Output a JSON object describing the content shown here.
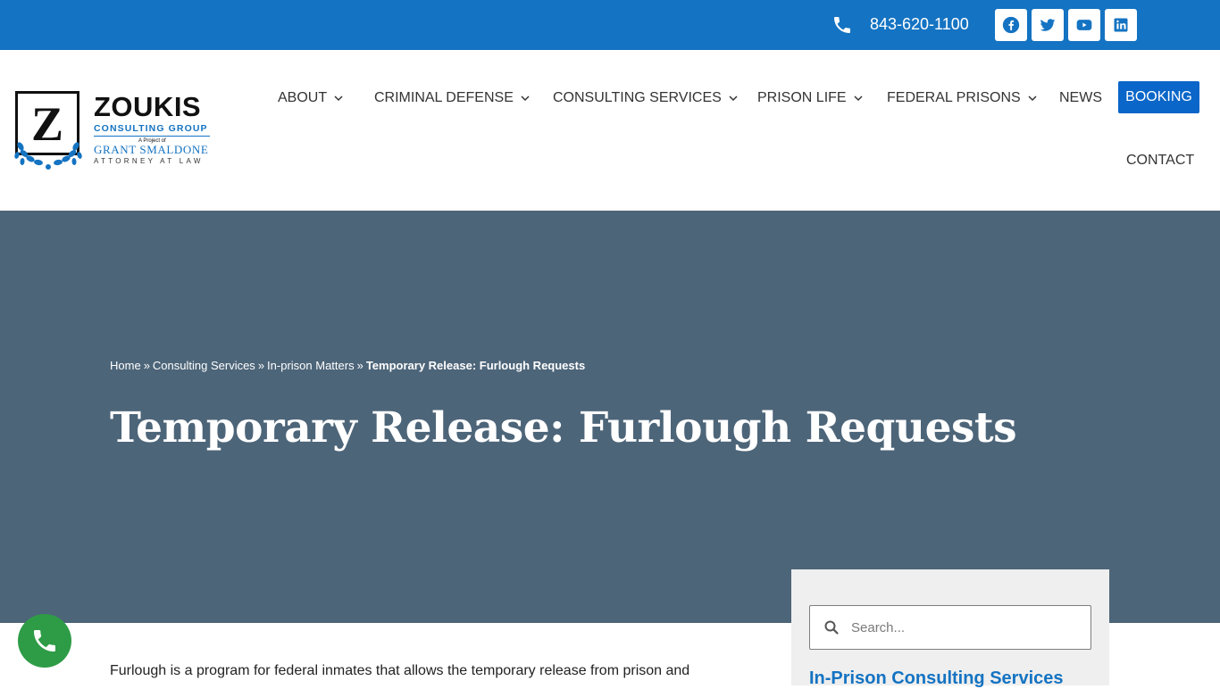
{
  "topbar": {
    "phone": "843-620-1100",
    "social": [
      "facebook-icon",
      "twitter-icon",
      "youtube-icon",
      "linkedin-icon"
    ],
    "background_color": "#1473c2"
  },
  "logo": {
    "monogram": "Z",
    "name": "ZOUKIS",
    "subtitle": "CONSULTING GROUP",
    "project_of": "A Project of",
    "attorney": "GRANT SMALDONE",
    "attorney_title": "ATTORNEY AT LAW"
  },
  "nav": {
    "items": [
      {
        "label": "ABOUT"
      },
      {
        "label": "CRIMINAL DEFENSE"
      },
      {
        "label": "CONSULTING SERVICES"
      },
      {
        "label": "PRISON LIFE"
      },
      {
        "label": "FEDERAL PRISONS"
      },
      {
        "label": "NEWS"
      }
    ],
    "booking": "BOOKING",
    "contact": "CONTACT",
    "booking_color": "#0a66c8"
  },
  "hero": {
    "breadcrumb": [
      "Home",
      "Consulting Services",
      "In-prison Matters",
      "Temporary Release: Furlough Requests"
    ],
    "separator": "»",
    "title": "Temporary Release: Furlough Requests",
    "background_color": "#4d6579"
  },
  "content": {
    "intro": "Furlough is a program for federal inmates that allows the temporary release from prison and"
  },
  "sidebar": {
    "search_placeholder": "Search...",
    "heading": "In-Prison Consulting Services"
  },
  "float_button": {
    "icon": "phone-icon",
    "color": "#2e9c46"
  }
}
